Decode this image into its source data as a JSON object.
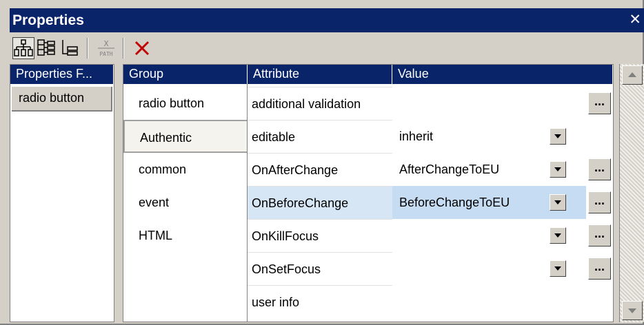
{
  "window": {
    "title": "Properties",
    "close_glyph": "✕"
  },
  "toolbar": {
    "buttons": [
      {
        "icon": "hierarchy-tree-icon",
        "pressed": true
      },
      {
        "icon": "expand-tree-icon",
        "pressed": false
      },
      {
        "icon": "collapse-tree-icon",
        "pressed": false
      },
      {
        "icon": "xpath-icon",
        "pressed": false,
        "label": "PATH"
      },
      {
        "icon": "delete-icon",
        "pressed": false,
        "color": "#c00000"
      }
    ]
  },
  "left_panel": {
    "header": "Properties F...",
    "items": [
      "radio button"
    ]
  },
  "main_panel": {
    "headers": {
      "group": "Group",
      "attribute": "Attribute",
      "value": "Value"
    },
    "groups": [
      "radio button",
      "Authentic",
      "common",
      "event",
      "HTML"
    ],
    "rows": [
      {
        "attribute": "additional validation",
        "value": ""
      },
      {
        "attribute": "editable",
        "value": "inherit"
      },
      {
        "attribute": "OnAfterChange",
        "value": "AfterChangeToEU"
      },
      {
        "attribute": "OnBeforeChange",
        "value": "BeforeChangeToEU"
      },
      {
        "attribute": "OnKillFocus",
        "value": ""
      },
      {
        "attribute": "OnSetFocus",
        "value": ""
      },
      {
        "attribute": "user info",
        "value": ""
      }
    ],
    "ellipsis_label": "..."
  },
  "colors": {
    "title_bar": "#0a246a",
    "selection": "#c6dcf3",
    "face": "#d4d0c8"
  }
}
